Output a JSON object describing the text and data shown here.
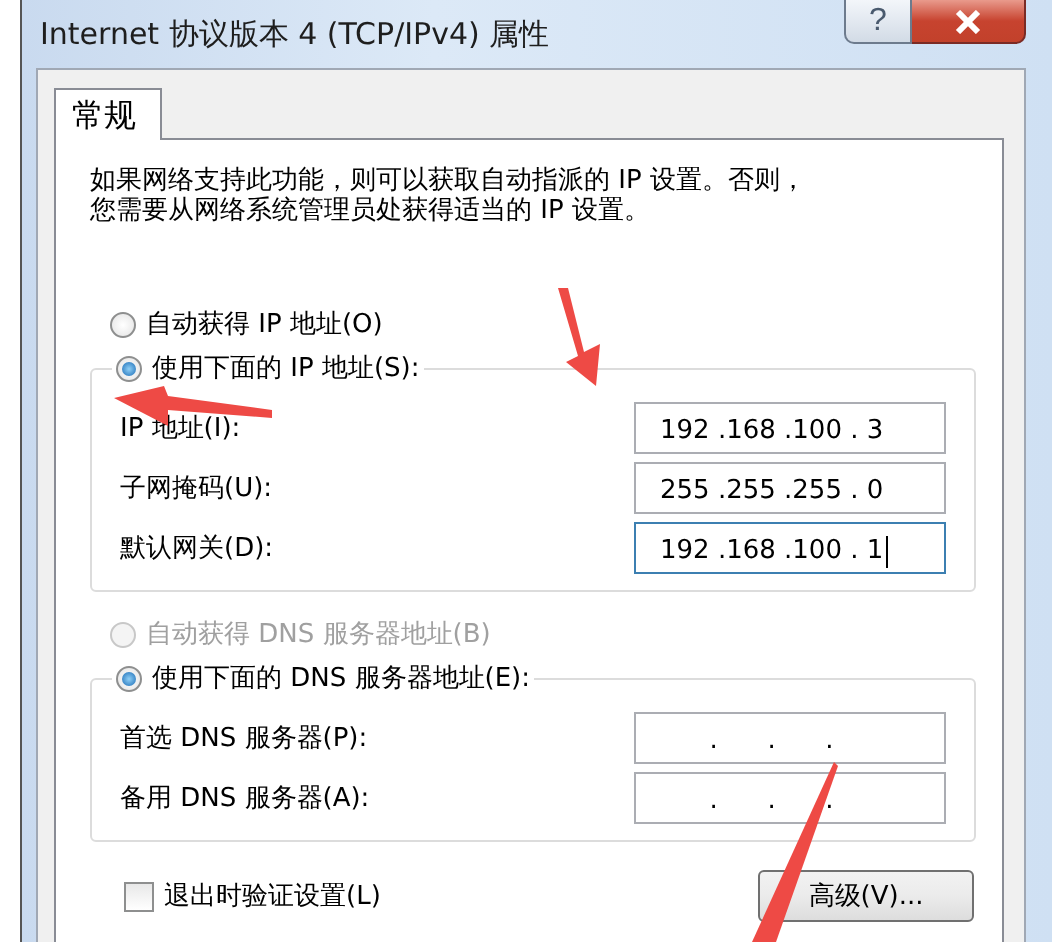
{
  "window": {
    "title": "Internet 协议版本 4 (TCP/IPv4) 属性",
    "help_button": "?"
  },
  "tabs": [
    {
      "label": "常规",
      "selected": true
    }
  ],
  "description": [
    "如果网络支持此功能，则可以获取自动指派的 IP 设置。否则，",
    "您需要从网络系统管理员处获得适当的 IP 设置。"
  ],
  "ip_group": {
    "radios": [
      {
        "label": "自动获得 IP 地址(O)",
        "selected": false,
        "disabled": false
      },
      {
        "label": "使用下面的 IP 地址(S):",
        "selected": true,
        "disabled": false
      }
    ],
    "fields": [
      {
        "label": "IP 地址(I):",
        "value": "192 .168 .100 . 3",
        "focused": false
      },
      {
        "label": "子网掩码(U):",
        "value": "255 .255 .255 . 0",
        "focused": false
      },
      {
        "label": "默认网关(D):",
        "value": "192 .168 .100 . 1",
        "focused": true
      }
    ]
  },
  "dns_group": {
    "radios": [
      {
        "label": "自动获得 DNS 服务器地址(B)",
        "selected": false,
        "disabled": true
      },
      {
        "label": "使用下面的 DNS 服务器地址(E):",
        "selected": true,
        "disabled": false
      }
    ],
    "fields": [
      {
        "label": "首选 DNS 服务器(P):",
        "value": "      .      .      .",
        "focused": false
      },
      {
        "label": "备用 DNS 服务器(A):",
        "value": "      .      .      .",
        "focused": false
      }
    ]
  },
  "validate_checkbox": {
    "label": "退出时验证设置(L)",
    "checked": false
  },
  "advanced_button": "高级(V)..."
}
